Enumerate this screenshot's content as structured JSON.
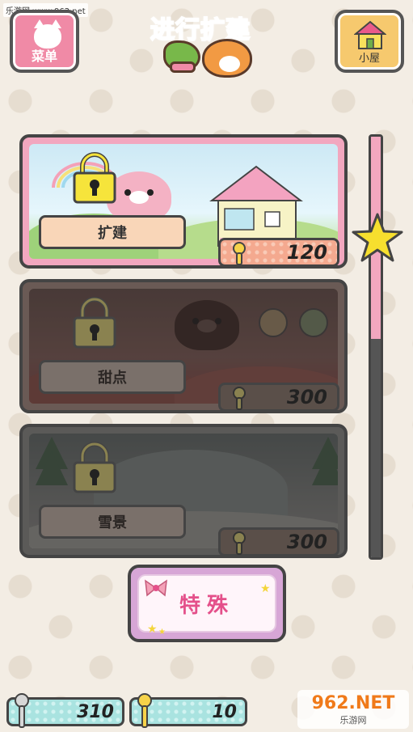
{
  "header": {
    "watermark_site": "乐游网 www.962.net",
    "menu_label": "菜单",
    "title": "进行扩建",
    "house_label": "小屋"
  },
  "cards": [
    {
      "name": "扩建",
      "cost": "120",
      "locked": true,
      "status": "available"
    },
    {
      "name": "甜点",
      "cost": "300",
      "locked": true,
      "status": "dimmed"
    },
    {
      "name": "雪景",
      "cost": "300",
      "locked": true,
      "status": "dimmed"
    }
  ],
  "progress": {
    "fill_fraction": 0.48
  },
  "special_button": {
    "label": "特殊"
  },
  "currency": {
    "silver": "310",
    "gold": "10"
  },
  "watermark_logo": {
    "main": "962.NET",
    "sub": "乐游网"
  },
  "colors": {
    "pink_accent": "#f08aa6",
    "yellow_lock": "#f6e43b",
    "title_green": "#4e8a33",
    "special_pink": "#e4508a",
    "currency_teal": "#a9e3e0"
  },
  "icons": [
    "cat-icon",
    "house-icon",
    "lock-icon",
    "key-icon",
    "star-icon",
    "hammer-icon",
    "hamster-icon"
  ]
}
